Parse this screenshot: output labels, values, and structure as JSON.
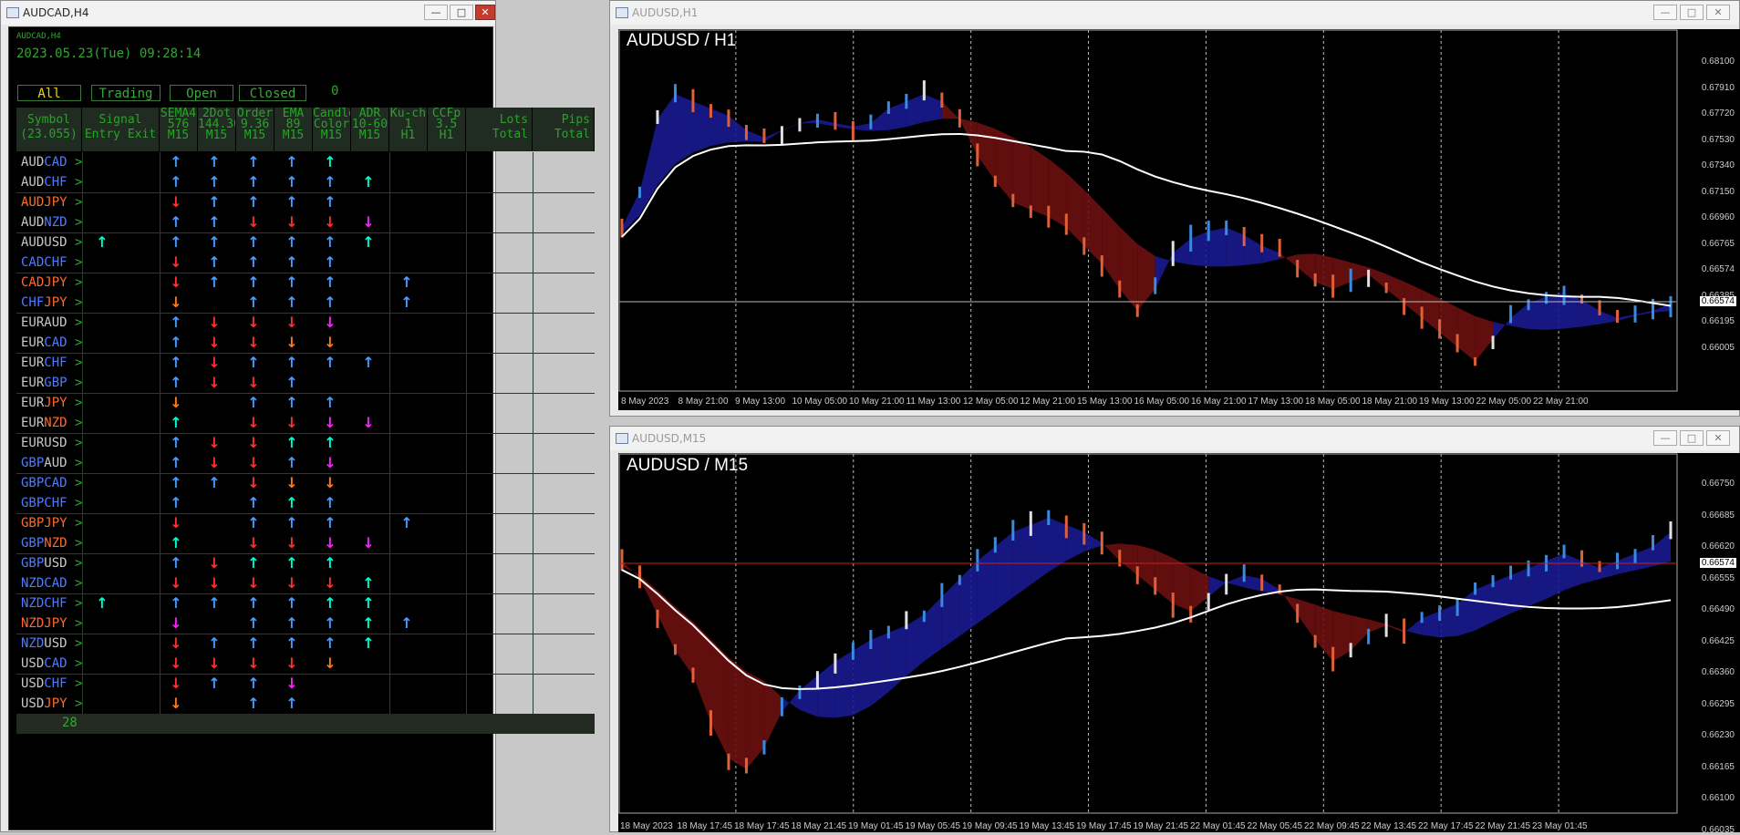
{
  "left_window": {
    "title": "AUDCAD,H4",
    "small_label": "AUDCAD,H4",
    "datetime": "2023.05.23(Tue) 09:28:14",
    "tabs": [
      "All",
      "Trading",
      "Open",
      "Closed"
    ],
    "count": "0",
    "headers": {
      "symbol": [
        "Symbol",
        "(23.055)"
      ],
      "signal": [
        "Signal",
        "Entry Exit"
      ],
      "sema": [
        "SEMA4",
        "576",
        "M15"
      ],
      "dot2": [
        "2Dot",
        "144.36",
        "M15"
      ],
      "order": [
        "Order",
        "9.36",
        "M15"
      ],
      "ema": [
        "EMA",
        "89",
        "M15"
      ],
      "candle": [
        "Candle",
        "Color",
        "M15"
      ],
      "adr": [
        "ADR",
        "10-60",
        "M15"
      ],
      "kuch": [
        "Ku-ch",
        "1",
        "H1"
      ],
      "ccfp": [
        "CCFp",
        "3.5",
        "H1"
      ],
      "lots": [
        "Lots",
        "Total"
      ],
      "pips": [
        "Pips",
        "Total"
      ]
    },
    "footer_count": "28",
    "rows": [
      {
        "base": "AUD",
        "quote": "CAD",
        "bc": "#c8c8c8",
        "qc": "#4e7cff",
        "entry": "",
        "c": [
          "u",
          "u",
          "u",
          "u",
          "g",
          "",
          ""
        ]
      },
      {
        "base": "AUD",
        "quote": "CHF",
        "bc": "#c8c8c8",
        "qc": "#4e7cff",
        "entry": "",
        "c": [
          "u",
          "u",
          "u",
          "u",
          "u",
          "g",
          ""
        ]
      },
      {
        "base": "AUD",
        "quote": "JPY",
        "bc": "#ff6a2a",
        "qc": "#ff6a2a",
        "entry": "",
        "c": [
          "r",
          "u",
          "u",
          "u",
          "u",
          "",
          ""
        ]
      },
      {
        "base": "AUD",
        "quote": "NZD",
        "bc": "#c8c8c8",
        "qc": "#4e7cff",
        "entry": "",
        "c": [
          "u",
          "u",
          "r",
          "r",
          "r",
          "m",
          ""
        ]
      },
      {
        "base": "AUD",
        "quote": "USD",
        "bc": "#c8c8c8",
        "qc": "#c8c8c8",
        "entry": "g",
        "c": [
          "u",
          "u",
          "u",
          "u",
          "u",
          "g",
          ""
        ]
      },
      {
        "base": "CAD",
        "quote": "CHF",
        "bc": "#4e7cff",
        "qc": "#4e7cff",
        "entry": "",
        "c": [
          "r",
          "u",
          "u",
          "u",
          "u",
          "",
          ""
        ]
      },
      {
        "base": "CAD",
        "quote": "JPY",
        "bc": "#ff6a2a",
        "qc": "#ff6a2a",
        "entry": "",
        "c": [
          "r",
          "u",
          "u",
          "u",
          "u",
          "",
          "u"
        ]
      },
      {
        "base": "CHF",
        "quote": "JPY",
        "bc": "#4e7cff",
        "qc": "#ff6a2a",
        "entry": "",
        "c": [
          "o",
          "",
          "u",
          "u",
          "u",
          "",
          "u"
        ]
      },
      {
        "base": "EUR",
        "quote": "AUD",
        "bc": "#c8c8c8",
        "qc": "#c8c8c8",
        "entry": "",
        "c": [
          "u",
          "r",
          "r",
          "r",
          "m",
          "",
          ""
        ]
      },
      {
        "base": "EUR",
        "quote": "CAD",
        "bc": "#c8c8c8",
        "qc": "#4e7cff",
        "entry": "",
        "c": [
          "u",
          "r",
          "r",
          "o",
          "o",
          "",
          ""
        ]
      },
      {
        "base": "EUR",
        "quote": "CHF",
        "bc": "#c8c8c8",
        "qc": "#4e7cff",
        "entry": "",
        "c": [
          "u",
          "r",
          "u",
          "u",
          "u",
          "u",
          ""
        ]
      },
      {
        "base": "EUR",
        "quote": "GBP",
        "bc": "#c8c8c8",
        "qc": "#4e7cff",
        "entry": "",
        "c": [
          "u",
          "r",
          "r",
          "u",
          "",
          "",
          ""
        ]
      },
      {
        "base": "EUR",
        "quote": "JPY",
        "bc": "#c8c8c8",
        "qc": "#ff6a2a",
        "entry": "",
        "c": [
          "o",
          "",
          "u",
          "u",
          "u",
          "",
          ""
        ]
      },
      {
        "base": "EUR",
        "quote": "NZD",
        "bc": "#c8c8c8",
        "qc": "#ff6a2a",
        "entry": "",
        "c": [
          "g",
          "",
          "r",
          "r",
          "m",
          "m",
          ""
        ]
      },
      {
        "base": "EUR",
        "quote": "USD",
        "bc": "#c8c8c8",
        "qc": "#c8c8c8",
        "entry": "",
        "c": [
          "u",
          "r",
          "r",
          "g",
          "g",
          "",
          ""
        ]
      },
      {
        "base": "GBP",
        "quote": "AUD",
        "bc": "#4e7cff",
        "qc": "#c8c8c8",
        "entry": "",
        "c": [
          "u",
          "r",
          "r",
          "u",
          "m",
          "",
          ""
        ]
      },
      {
        "base": "GBP",
        "quote": "CAD",
        "bc": "#4e7cff",
        "qc": "#4e7cff",
        "entry": "",
        "c": [
          "u",
          "u",
          "r",
          "o",
          "o",
          "",
          ""
        ]
      },
      {
        "base": "GBP",
        "quote": "CHF",
        "bc": "#4e7cff",
        "qc": "#4e7cff",
        "entry": "",
        "c": [
          "u",
          "",
          "u",
          "g",
          "u",
          "",
          ""
        ]
      },
      {
        "base": "GBP",
        "quote": "JPY",
        "bc": "#ff6a2a",
        "qc": "#ff6a2a",
        "entry": "",
        "c": [
          "r",
          "",
          "u",
          "u",
          "u",
          "",
          "u"
        ]
      },
      {
        "base": "GBP",
        "quote": "NZD",
        "bc": "#4e7cff",
        "qc": "#ff6a2a",
        "entry": "",
        "c": [
          "g",
          "",
          "r",
          "r",
          "m",
          "m",
          ""
        ]
      },
      {
        "base": "GBP",
        "quote": "USD",
        "bc": "#4e7cff",
        "qc": "#c8c8c8",
        "entry": "",
        "c": [
          "u",
          "r",
          "g",
          "g",
          "g",
          "",
          ""
        ]
      },
      {
        "base": "NZD",
        "quote": "CAD",
        "bc": "#4e7cff",
        "qc": "#4e7cff",
        "entry": "",
        "c": [
          "r",
          "r",
          "r",
          "r",
          "r",
          "g",
          ""
        ]
      },
      {
        "base": "NZD",
        "quote": "CHF",
        "bc": "#4e7cff",
        "qc": "#4e7cff",
        "entry": "g",
        "c": [
          "u",
          "u",
          "u",
          "u",
          "g",
          "g",
          ""
        ]
      },
      {
        "base": "NZD",
        "quote": "JPY",
        "bc": "#ff6a2a",
        "qc": "#ff6a2a",
        "entry": "",
        "c": [
          "m",
          "",
          "u",
          "u",
          "u",
          "g",
          "u"
        ]
      },
      {
        "base": "NZD",
        "quote": "USD",
        "bc": "#4e7cff",
        "qc": "#c8c8c8",
        "entry": "",
        "c": [
          "r",
          "u",
          "u",
          "u",
          "u",
          "g",
          ""
        ]
      },
      {
        "base": "USD",
        "quote": "CAD",
        "bc": "#c8c8c8",
        "qc": "#4e7cff",
        "entry": "",
        "c": [
          "r",
          "r",
          "r",
          "r",
          "o",
          "",
          ""
        ]
      },
      {
        "base": "USD",
        "quote": "CHF",
        "bc": "#c8c8c8",
        "qc": "#4e7cff",
        "entry": "",
        "c": [
          "r",
          "u",
          "u",
          "m",
          "",
          "",
          ""
        ]
      },
      {
        "base": "USD",
        "quote": "JPY",
        "bc": "#c8c8c8",
        "qc": "#ff6a2a",
        "entry": "",
        "c": [
          "o",
          "",
          "u",
          "u",
          "",
          "",
          ""
        ]
      }
    ]
  },
  "chart_h1": {
    "window_title": "AUDUSD,H1",
    "label": "AUDUSD / H1",
    "prices": [
      "0.68100",
      "0.67910",
      "0.67720",
      "0.67530",
      "0.67340",
      "0.67150",
      "0.66960",
      "0.66765",
      "0.66574",
      "0.66385",
      "0.66195",
      "0.66005"
    ],
    "current_price": "0.66574",
    "times": [
      "8 May 2023",
      "8 May 21:00",
      "9 May 13:00",
      "10 May 05:00",
      "10 May 21:00",
      "11 May 13:00",
      "12 May 05:00",
      "12 May 21:00",
      "15 May 13:00",
      "16 May 05:00",
      "16 May 21:00",
      "17 May 13:00",
      "18 May 05:00",
      "18 May 21:00",
      "19 May 13:00",
      "22 May 05:00",
      "22 May 21:00"
    ]
  },
  "chart_m15": {
    "window_title": "AUDUSD,M15",
    "label": "AUDUSD / M15",
    "prices": [
      "0.66750",
      "0.66685",
      "0.66620",
      "0.66555",
      "0.66490",
      "0.66425",
      "0.66360",
      "0.66295",
      "0.66230",
      "0.66165",
      "0.66100",
      "0.66035"
    ],
    "current_price": "0.66574",
    "times": [
      "18 May 2023",
      "18 May 17:45",
      "18 May 17:45",
      "18 May 21:45",
      "19 May 01:45",
      "19 May 05:45",
      "19 May 09:45",
      "19 May 13:45",
      "19 May 17:45",
      "19 May 21:45",
      "22 May 01:45",
      "22 May 05:45",
      "22 May 09:45",
      "22 May 13:45",
      "22 May 17:45",
      "22 May 21:45",
      "23 May 01:45"
    ]
  },
  "colors": {
    "up_arrow": "#4a9cff",
    "down_arrow": "#ff3030",
    "green_arrow": "#00ffd0",
    "orange_arrow": "#ff7a1a",
    "magenta_arrow": "#ff20ff"
  }
}
